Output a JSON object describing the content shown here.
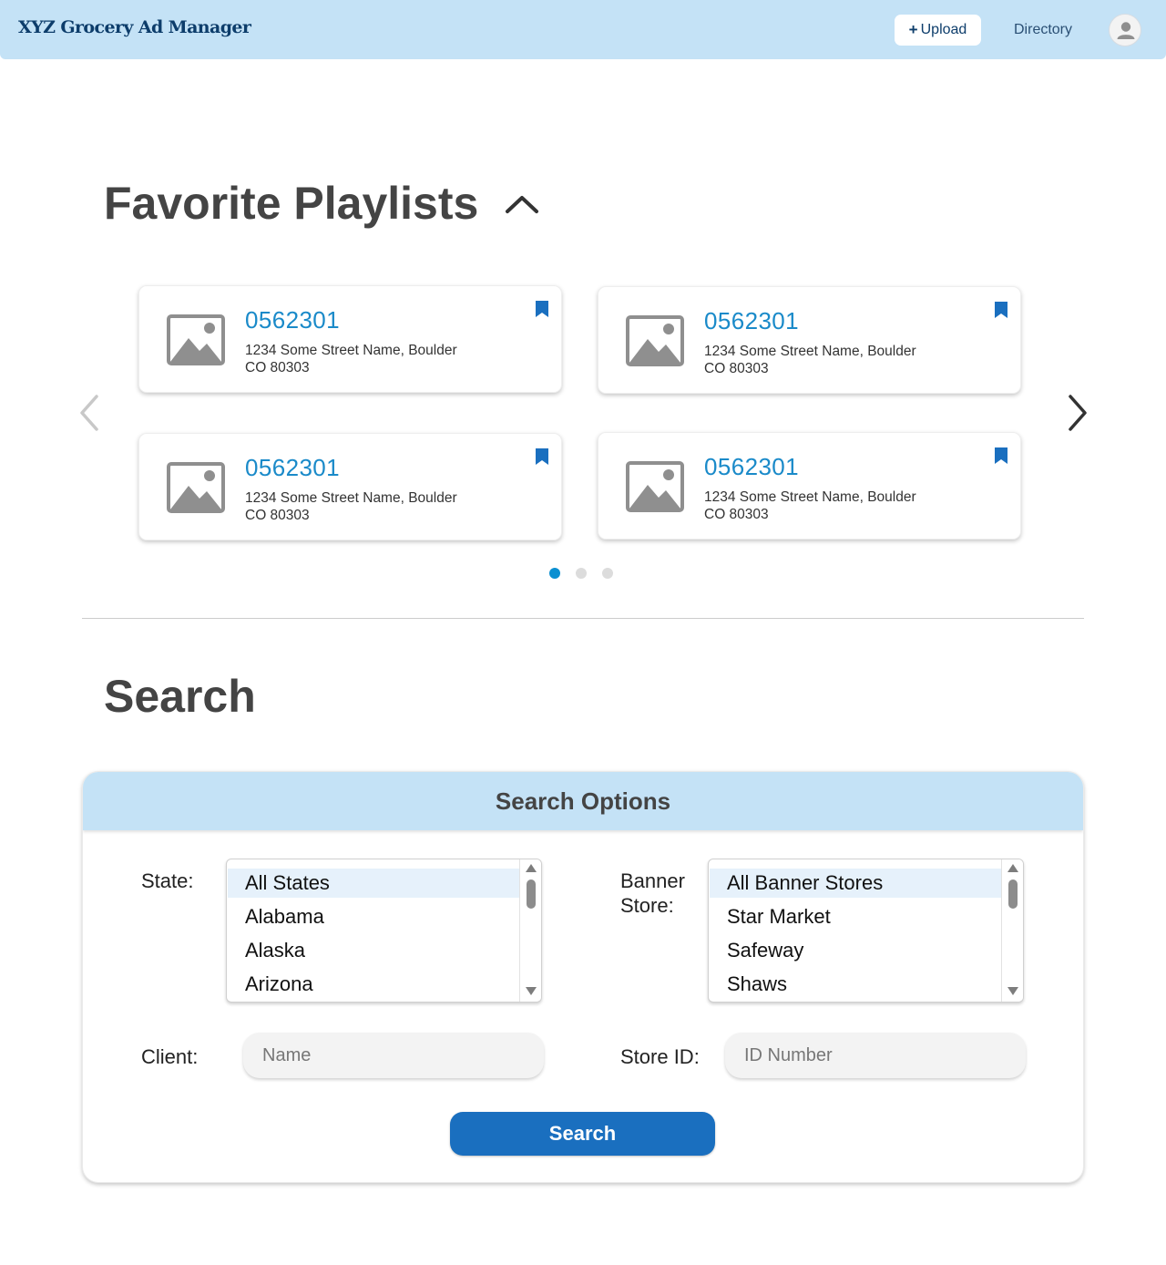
{
  "header": {
    "brand": "XYZ Grocery Ad Manager",
    "upload_plus": "+",
    "upload_label": "Upload",
    "directory_label": "Directory"
  },
  "favorites": {
    "title": "Favorite Playlists",
    "cards": [
      {
        "id": "0562301",
        "address_line1": "1234 Some Street Name, Boulder",
        "address_line2": "CO 80303"
      },
      {
        "id": "0562301",
        "address_line1": "1234 Some Street Name, Boulder",
        "address_line2": "CO 80303"
      },
      {
        "id": "0562301",
        "address_line1": "1234 Some Street Name, Boulder",
        "address_line2": "CO 80303"
      },
      {
        "id": "0562301",
        "address_line1": "1234 Some Street Name, Boulder",
        "address_line2": "CO 80303"
      }
    ],
    "pagination": {
      "pages": 3,
      "current": 1
    }
  },
  "search": {
    "title": "Search",
    "panel_title": "Search Options",
    "state_label": "State:",
    "state_options": [
      "All States",
      "Alabama",
      "Alaska",
      "Arizona"
    ],
    "state_selected": "All States",
    "banner_label_line1": "Banner",
    "banner_label_line2": "Store:",
    "banner_options": [
      "All Banner Stores",
      "Star Market",
      "Safeway",
      "Shaws"
    ],
    "banner_selected": "All Banner Stores",
    "client_label": "Client:",
    "client_placeholder": "Name",
    "store_id_label": "Store ID:",
    "store_id_placeholder": "ID Number",
    "button_label": "Search"
  },
  "colors": {
    "header_bg": "#c4e2f6",
    "brand_text": "#0d3d6b",
    "card_id": "#1a8ac9",
    "bookmark": "#1a6fbf",
    "dot_active": "#0b8fd1",
    "button_bg": "#1a6fbf"
  },
  "icons": {
    "upload": "plus-icon",
    "avatar": "user-icon",
    "collapse": "chevron-up-icon",
    "card_image": "image-placeholder-icon",
    "card_bookmark": "bookmark-icon",
    "prev": "chevron-left-icon",
    "next": "chevron-right-icon"
  }
}
